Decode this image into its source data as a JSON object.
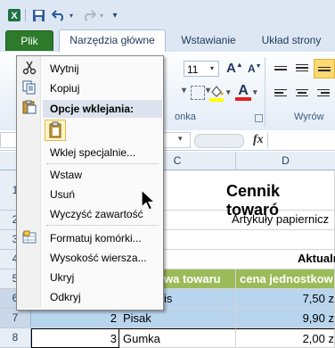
{
  "quick_access": {
    "save_icon": "save-icon",
    "undo_icon": "undo-icon",
    "redo_icon": "redo-icon",
    "customize": "▾"
  },
  "tabs": {
    "file": "Plik",
    "home": "Narzędzia główne",
    "insert": "Wstawianie",
    "layout": "Układ strony"
  },
  "ribbon": {
    "font_size": "11",
    "grow_font": "A",
    "shrink_font": "A",
    "font_color_letter": "A",
    "group_font_label": "onka",
    "group_align_label": "Wyrów"
  },
  "formula_bar": {
    "fx": "fx"
  },
  "columns": [
    "C",
    "D"
  ],
  "rows": [
    "1",
    "2",
    "3",
    "4",
    "5",
    "6",
    "7",
    "8"
  ],
  "cells": {
    "title": "Cennik towaró",
    "subtitle": "Artykuły papiernicz",
    "aktual": "Aktualn",
    "hdr_name": "wa towaru",
    "hdr_price": "cena jednostkow",
    "r6_name": "is",
    "r6_price": "7,50 z",
    "r7_num": "2",
    "r7_name": "Pisak",
    "r7_price": "9,90 z",
    "r8_num": "3",
    "r8_name": "Gumka",
    "r8_price": "2,00 z"
  },
  "context_menu": {
    "cut": "Wytnij",
    "copy": "Kopiuj",
    "paste_header": "Opcje wklejania:",
    "paste_special": "Wklej specjalnie...",
    "insert": "Wstaw",
    "delete": "Usuń",
    "clear": "Wyczyść zawartość",
    "format_cells": "Formatuj komórki...",
    "row_height": "Wysokość wiersza...",
    "hide": "Ukryj",
    "unhide": "Odkryj"
  },
  "colors": {
    "file_tab": "#2c7a2a",
    "header_fill": "#9bbb59",
    "selection_fill": "#b8d5ee",
    "font_color_bar": "#e02020",
    "highlight_bar": "#ffff00"
  }
}
